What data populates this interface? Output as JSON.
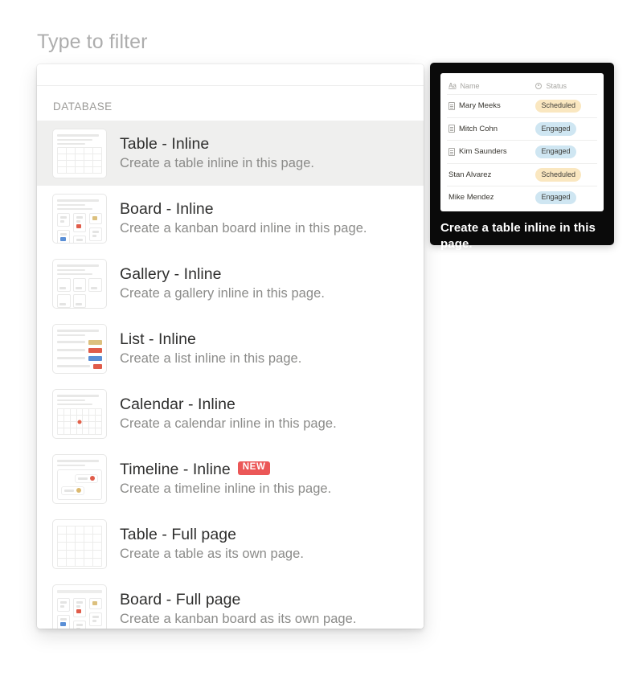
{
  "filter": {
    "placeholder": "Type to filter"
  },
  "menu": {
    "section_label": "DATABASE",
    "items": [
      {
        "title": "Table - Inline",
        "desc": "Create a table inline in this page.",
        "icon": "table-inline-icon",
        "badge": "",
        "selected": true
      },
      {
        "title": "Board - Inline",
        "desc": "Create a kanban board inline in this page.",
        "icon": "board-inline-icon",
        "badge": "",
        "selected": false
      },
      {
        "title": "Gallery - Inline",
        "desc": "Create a gallery inline in this page.",
        "icon": "gallery-inline-icon",
        "badge": "",
        "selected": false
      },
      {
        "title": "List - Inline",
        "desc": "Create a list inline in this page.",
        "icon": "list-inline-icon",
        "badge": "",
        "selected": false
      },
      {
        "title": "Calendar - Inline",
        "desc": "Create a calendar inline in this page.",
        "icon": "calendar-inline-icon",
        "badge": "",
        "selected": false
      },
      {
        "title": "Timeline - Inline",
        "desc": "Create a timeline inline in this page.",
        "icon": "timeline-inline-icon",
        "badge": "NEW",
        "selected": false
      },
      {
        "title": "Table - Full page",
        "desc": "Create a table as its own page.",
        "icon": "table-fullpage-icon",
        "badge": "",
        "selected": false
      },
      {
        "title": "Board - Full page",
        "desc": "Create a kanban board as its own page.",
        "icon": "board-fullpage-icon",
        "badge": "",
        "selected": false
      }
    ]
  },
  "preview": {
    "caption": "Create a table inline in this page.",
    "table": {
      "columns": [
        {
          "label": "Name",
          "icon": "text-property-icon"
        },
        {
          "label": "Status",
          "icon": "select-property-icon"
        }
      ],
      "rows": [
        {
          "name": "Mary Meeks",
          "status": "Scheduled",
          "status_color": "#fae7c0",
          "has_page_icon": true
        },
        {
          "name": "Mitch Cohn",
          "status": "Engaged",
          "status_color": "#cfe6f2",
          "has_page_icon": true
        },
        {
          "name": "Kim Saunders",
          "status": "Engaged",
          "status_color": "#cfe6f2",
          "has_page_icon": true
        },
        {
          "name": "Stan Alvarez",
          "status": "Scheduled",
          "status_color": "#fae7c0",
          "has_page_icon": false
        },
        {
          "name": "Mike Mendez",
          "status": "Engaged",
          "status_color": "#cfe6f2",
          "has_page_icon": false
        }
      ]
    }
  },
  "colors": {
    "badge_new": "#eb5757",
    "selected_row": "#efefee",
    "tooltip_bg": "#0a0a0a",
    "accent_red": "#e05c4a",
    "accent_blue": "#5a8fd6",
    "accent_tan": "#dcc07e"
  }
}
